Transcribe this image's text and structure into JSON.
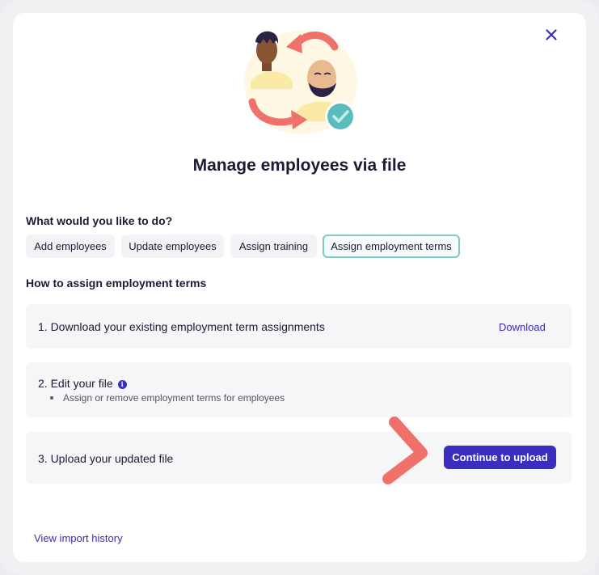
{
  "dialog": {
    "title": "Manage employees via file",
    "question": "What would you like to do?",
    "options": [
      {
        "label": "Add employees",
        "selected": false
      },
      {
        "label": "Update employees",
        "selected": false
      },
      {
        "label": "Assign training",
        "selected": false
      },
      {
        "label": "Assign employment terms",
        "selected": true
      }
    ],
    "how_heading": "How to assign employment terms",
    "steps": [
      {
        "text": "1. Download your existing employment term assignments",
        "action": "Download"
      },
      {
        "text": "2. Edit your file",
        "bullet": "Assign or remove employment terms for employees"
      },
      {
        "text": "3. Upload your updated file",
        "action": "Continue to upload"
      }
    ],
    "history_link": "View import history"
  },
  "icons": {
    "close": "close-icon",
    "info": "info-icon",
    "pointer": "pointer-arrow-icon"
  },
  "colors": {
    "accent": "#3a2dbf",
    "selected_border": "#7fc8c4",
    "arrow": "#f0706a",
    "check": "#5bbdbb"
  }
}
